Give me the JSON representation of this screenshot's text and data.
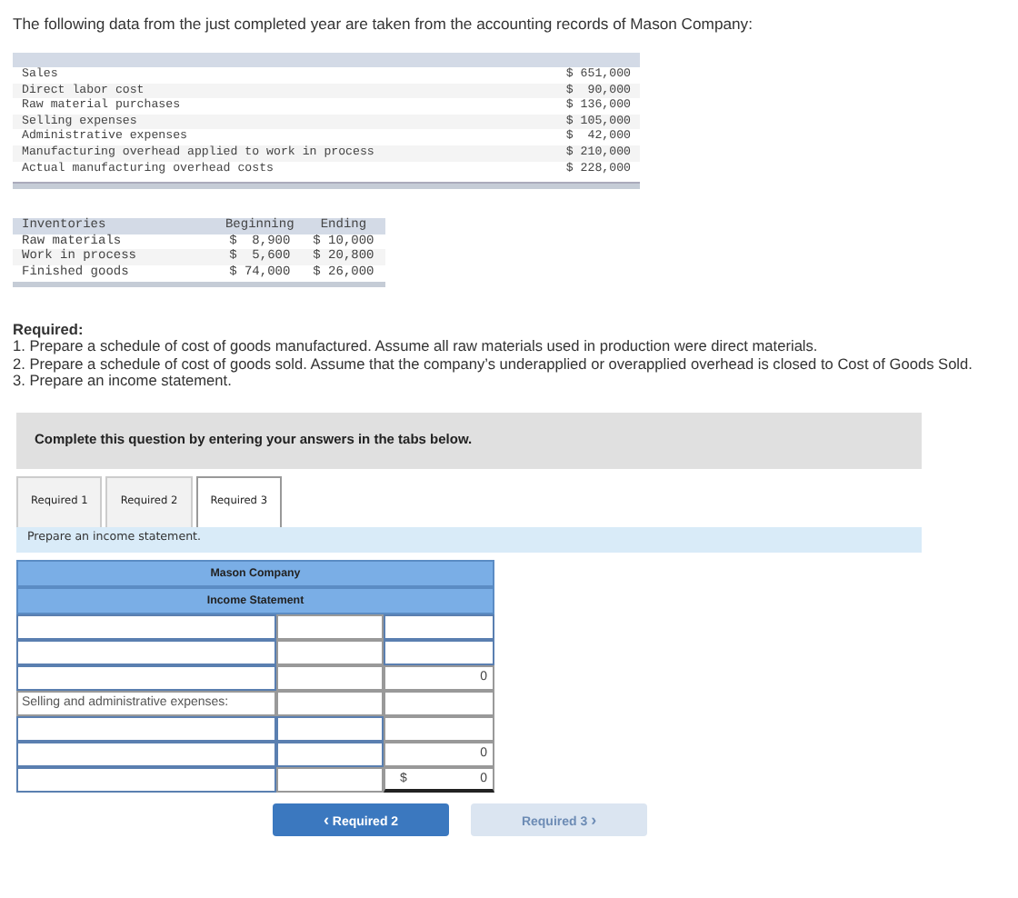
{
  "intro": "The following data from the just completed year are taken from the accounting records of Mason Company:",
  "data_table": {
    "rows": [
      {
        "label": "Sales",
        "amount": "$ 651,000"
      },
      {
        "label": "Direct labor cost",
        "amount": "$  90,000"
      },
      {
        "label": "Raw material purchases",
        "amount": "$ 136,000"
      },
      {
        "label": "Selling expenses",
        "amount": "$ 105,000"
      },
      {
        "label": "Administrative expenses",
        "amount": "$  42,000"
      },
      {
        "label": "Manufacturing overhead applied to work in process",
        "amount": "$ 210,000"
      },
      {
        "label": "Actual manufacturing overhead costs",
        "amount": "$ 228,000"
      }
    ]
  },
  "inventory_table": {
    "columns": [
      "Inventories",
      "Beginning",
      "Ending"
    ],
    "rows": [
      [
        "Raw materials",
        "$  8,900",
        "$ 10,000"
      ],
      [
        "Work in process",
        "$  5,600",
        "$ 20,800"
      ],
      [
        "Finished goods",
        "$ 74,000",
        "$ 26,000"
      ]
    ]
  },
  "required": {
    "heading": "Required:",
    "items": [
      "1. Prepare a schedule of cost of goods manufactured. Assume all raw materials used in production were direct materials.",
      "2. Prepare a schedule of cost of goods sold. Assume that the company’s underapplied or overapplied overhead is closed to Cost of Goods Sold.",
      "3. Prepare an income statement."
    ]
  },
  "instruction": "Complete this question by entering your answers in the tabs below.",
  "tabs": [
    {
      "label": "Required 1",
      "selected": false
    },
    {
      "label": "Required 2",
      "selected": false
    },
    {
      "label": "Required 3",
      "selected": true
    }
  ],
  "prompt": "Prepare an income statement.",
  "statement": {
    "title": "Mason Company",
    "subtitle": "Income Statement",
    "rows": [
      [
        {
          "kind": "input"
        },
        {
          "kind": "blank"
        },
        {
          "kind": "input"
        }
      ],
      [
        {
          "kind": "input"
        },
        {
          "kind": "blank"
        },
        {
          "kind": "input"
        }
      ],
      [
        {
          "kind": "input"
        },
        {
          "kind": "blank"
        },
        {
          "kind": "amount",
          "value": "0"
        }
      ],
      [
        {
          "kind": "label",
          "text": "Selling and administrative expenses:"
        },
        {
          "kind": "blank"
        },
        {
          "kind": "blank"
        }
      ],
      [
        {
          "kind": "input"
        },
        {
          "kind": "input"
        },
        {
          "kind": "blank"
        }
      ],
      [
        {
          "kind": "input"
        },
        {
          "kind": "input"
        },
        {
          "kind": "amount",
          "value": "0"
        }
      ],
      [
        {
          "kind": "input"
        },
        {
          "kind": "blank"
        },
        {
          "kind": "amount",
          "currency": "$",
          "value": "0",
          "total": true
        }
      ]
    ]
  },
  "nav": [
    {
      "kind": "prev",
      "label": "Required 2",
      "icon": "‹",
      "disabled": false
    },
    {
      "kind": "next",
      "label": "Required 3",
      "icon": "›",
      "disabled": true
    }
  ]
}
